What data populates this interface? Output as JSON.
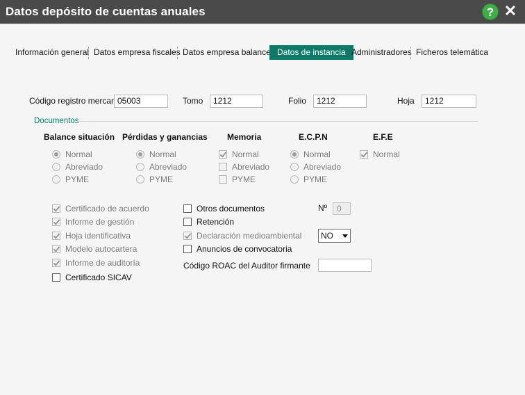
{
  "window": {
    "title": "Datos depósito de cuentas anuales",
    "help_icon": "question-icon",
    "help_label": "?",
    "close_icon": "close-icon",
    "close_label": "✕"
  },
  "tabs": [
    {
      "label": "Información general",
      "active": false
    },
    {
      "label": "Datos empresa fiscales",
      "active": false
    },
    {
      "label": "Datos empresa balances",
      "active": false
    },
    {
      "label": "Datos de instancia",
      "active": true
    },
    {
      "label": "Administradores",
      "active": false
    },
    {
      "label": "Ficheros telemática",
      "active": false
    }
  ],
  "registro": {
    "codigo_label": "Código registro mercantil",
    "codigo_value": "05003",
    "tomo_label": "Tomo",
    "tomo_value": "1212",
    "folio_label": "Folio",
    "folio_value": "1212",
    "hoja_label": "Hoja",
    "hoja_value": "1212"
  },
  "documentos": {
    "section_title": "Documentos",
    "groups": [
      {
        "title": "Balance situación",
        "options": [
          "Normal",
          "Abreviado",
          "PYME"
        ],
        "selected": "Normal"
      },
      {
        "title": "Pérdidas y ganancias",
        "options": [
          "Normal",
          "Abreviado",
          "PYME"
        ],
        "selected": "Normal"
      },
      {
        "title": "Memoria",
        "options": [
          "Normal",
          "Abreviado",
          "PYME"
        ],
        "checked": [
          "Normal"
        ]
      },
      {
        "title": "E.C.P.N",
        "options": [
          "Normal",
          "Abreviado",
          "PYME"
        ],
        "selected": "Normal"
      },
      {
        "title": "E.F.E",
        "options": [
          "Normal"
        ],
        "checked": [
          "Normal"
        ]
      }
    ]
  },
  "checks_left": [
    {
      "label": "Certificado de acuerdo",
      "checked": true,
      "enabled": false
    },
    {
      "label": "Informe de gestión",
      "checked": true,
      "enabled": false
    },
    {
      "label": "Hoja identificativa",
      "checked": true,
      "enabled": false
    },
    {
      "label": "Modelo autocartera",
      "checked": true,
      "enabled": false
    },
    {
      "label": "Informe de auditoría",
      "checked": true,
      "enabled": false
    },
    {
      "label": "Certificado SICAV",
      "checked": false,
      "enabled": true
    }
  ],
  "checks_right": [
    {
      "label": "Otros documentos",
      "checked": false,
      "enabled": true
    },
    {
      "label": "Retención",
      "checked": false,
      "enabled": true
    },
    {
      "label": "Declaración medioambiental",
      "checked": true,
      "enabled": false
    },
    {
      "label": "Anuncios de convocatoria",
      "checked": false,
      "enabled": true
    }
  ],
  "otros": {
    "num_label": "Nº",
    "num_value": "0",
    "medioambiental_value": "NO",
    "roac_label": "Código ROAC del Auditor firmante",
    "roac_value": ""
  }
}
